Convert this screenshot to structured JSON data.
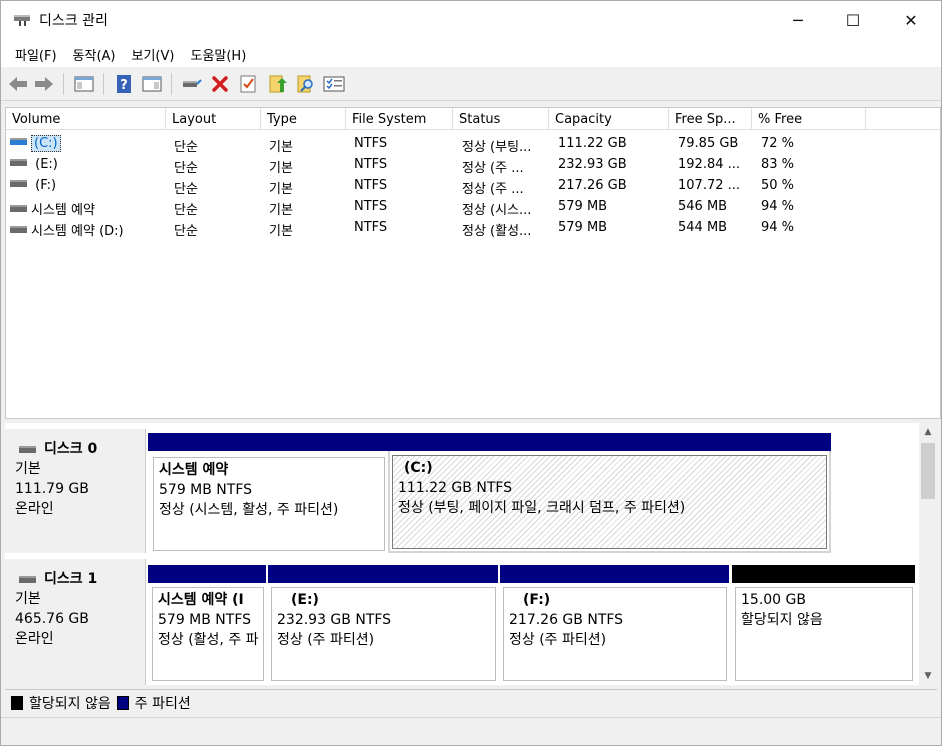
{
  "window": {
    "title": "디스크 관리",
    "minimize_glyph": "─",
    "maximize_glyph": "☐",
    "close_glyph": "✕"
  },
  "menu": [
    "파일(F)",
    "동작(A)",
    "보기(V)",
    "도움말(H)"
  ],
  "toolbar_icons": [
    "back-icon",
    "forward-icon",
    "show-hide-console-tree-icon",
    "help-icon",
    "show-hide-action-pane-icon",
    "connect-drive-icon",
    "delete-icon",
    "check-properties-icon",
    "up-folder-icon",
    "search-folder-icon",
    "options-list-icon"
  ],
  "columns": [
    "Volume",
    "Layout",
    "Type",
    "File System",
    "Status",
    "Capacity",
    "Free Sp...",
    "% Free"
  ],
  "volumes": [
    {
      "volume": "(C:)",
      "layout": "단순",
      "type": "기본",
      "fs": "NTFS",
      "status": "정상 (부팅...",
      "capacity": "111.22 GB",
      "free": "79.85 GB",
      "pct": "72 %"
    },
    {
      "volume": "(E:)",
      "layout": "단순",
      "type": "기본",
      "fs": "NTFS",
      "status": "정상 (주 ...",
      "capacity": "232.93 GB",
      "free": "192.84 ...",
      "pct": "83 %"
    },
    {
      "volume": "(F:)",
      "layout": "단순",
      "type": "기본",
      "fs": "NTFS",
      "status": "정상 (주 ...",
      "capacity": "217.26 GB",
      "free": "107.72 ...",
      "pct": "50 %"
    },
    {
      "volume": "시스템 예약",
      "layout": "단순",
      "type": "기본",
      "fs": "NTFS",
      "status": "정상 (시스...",
      "capacity": "579 MB",
      "free": "546 MB",
      "pct": "94 %"
    },
    {
      "volume": "시스템 예약 (D:)",
      "layout": "단순",
      "type": "기본",
      "fs": "NTFS",
      "status": "정상 (활성...",
      "capacity": "579 MB",
      "free": "544 MB",
      "pct": "94 %"
    }
  ],
  "disks": [
    {
      "name": "디스크 0",
      "kind": "기본",
      "size": "111.79 GB",
      "state": "온라인",
      "partitions": [
        {
          "name": "시스템 예약",
          "size": "579 MB NTFS",
          "status": "정상 (시스템, 활성, 주 파티션)"
        },
        {
          "name": "(C:)",
          "size": "111.22 GB NTFS",
          "status": "정상 (부팅, 페이지 파일, 크래시 덤프, 주 파티션)"
        }
      ]
    },
    {
      "name": "디스크 1",
      "kind": "기본",
      "size": "465.76 GB",
      "state": "온라인",
      "partitions": [
        {
          "name": "시스템 예약 (I",
          "size": "579 MB NTFS",
          "status": "정상 (활성, 주 파"
        },
        {
          "name": "(E:)",
          "size": "232.93 GB NTFS",
          "status": "정상 (주 파티션)"
        },
        {
          "name": "(F:)",
          "size": "217.26 GB NTFS",
          "status": "정상 (주 파티션)"
        },
        {
          "name": "",
          "size": "15.00 GB",
          "status": "할당되지 않음"
        }
      ]
    }
  ],
  "legend": [
    {
      "label": "할당되지 않음",
      "color": "#000000"
    },
    {
      "label": "주 파티션",
      "color": "#000080"
    }
  ],
  "colors": {
    "primary_partition": "#000080",
    "unallocated": "#000000",
    "selection": "#cce4f7"
  }
}
